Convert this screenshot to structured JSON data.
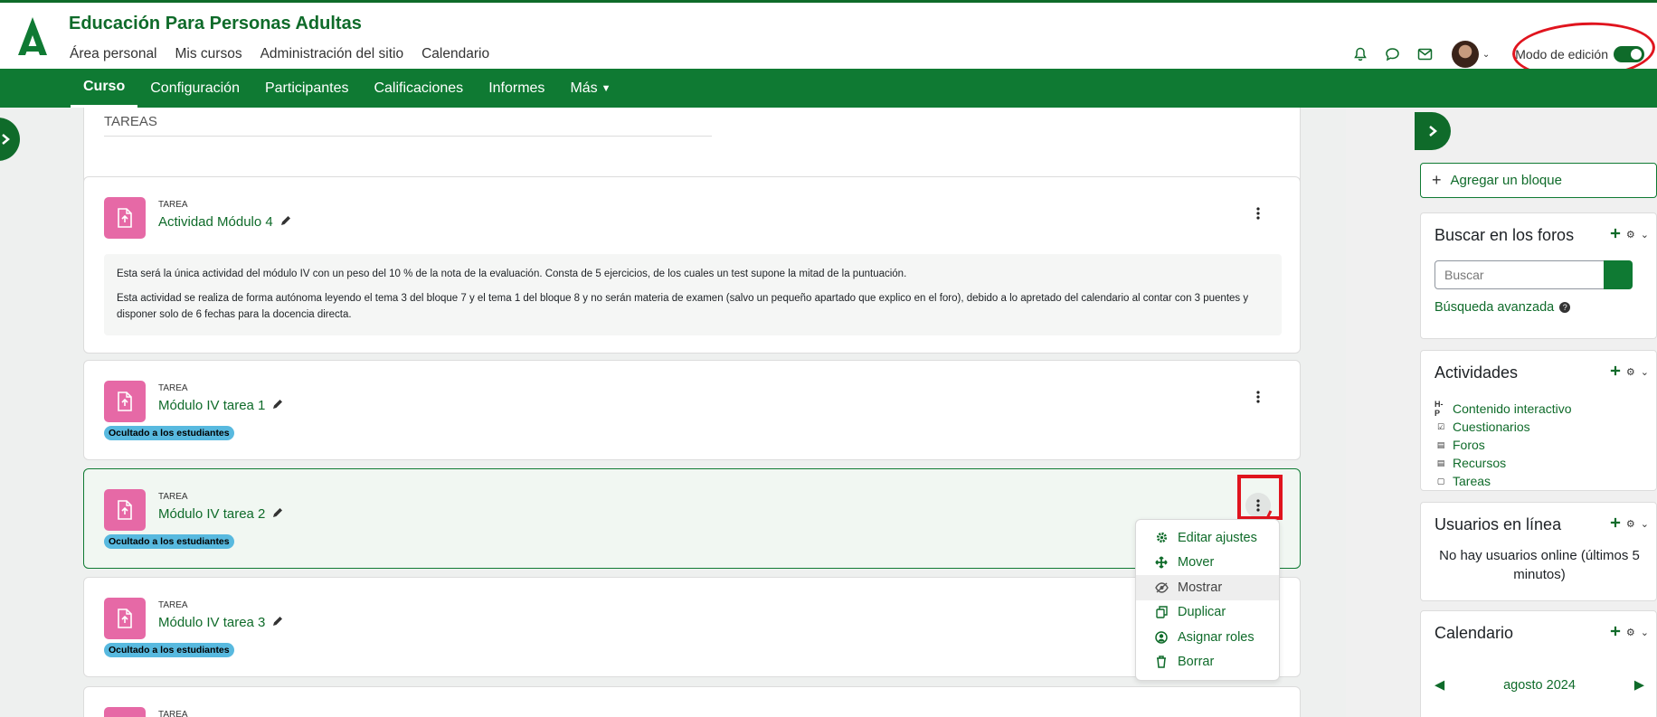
{
  "site": {
    "title": "Educación Para Personas Adultas"
  },
  "primary_nav": [
    "Área personal",
    "Mis cursos",
    "Administración del sitio",
    "Calendario"
  ],
  "header": {
    "edit_mode_label": "Modo de edición",
    "edit_mode_on": true
  },
  "secondary_nav": [
    "Curso",
    "Configuración",
    "Participantes",
    "Calificaciones",
    "Informes",
    "Más"
  ],
  "section_top": {
    "title": "TAREAS"
  },
  "activities": [
    {
      "type": "TAREA",
      "name": "Actividad Módulo 4",
      "description": [
        "Esta será la única actividad del módulo IV con un peso del 10 % de la nota de la evaluación. Consta de 5 ejercicios, de los cuales un test supone la mitad de la puntuación.",
        "Esta actividad se realiza de forma autónoma leyendo el tema 3 del bloque 7 y el tema 1 del bloque 8 y no serán materia de examen (salvo un pequeño apartado que explico en el foro), debido a lo apretado del calendario al contar con 3 puentes y disponer solo de 6 fechas para la docencia directa."
      ]
    },
    {
      "type": "TAREA",
      "name": "Módulo IV tarea 1",
      "badge": "Ocultado a los estudiantes"
    },
    {
      "type": "TAREA",
      "name": "Módulo IV tarea 2",
      "badge": "Ocultado a los estudiantes"
    },
    {
      "type": "TAREA",
      "name": "Módulo IV tarea 3",
      "badge": "Ocultado a los estudiantes"
    },
    {
      "type": "TAREA"
    }
  ],
  "action_menu": [
    "Editar ajustes",
    "Mover",
    "Mostrar",
    "Duplicar",
    "Asignar roles",
    "Borrar"
  ],
  "blocks": {
    "add_block": "Agregar un bloque",
    "forum_search": {
      "title": "Buscar en los foros",
      "placeholder": "Buscar",
      "advanced": "Búsqueda avanzada"
    },
    "activities": {
      "title": "Actividades",
      "items": [
        "Contenido interactivo",
        "Cuestionarios",
        "Foros",
        "Recursos",
        "Tareas"
      ]
    },
    "online_users": {
      "title": "Usuarios en línea",
      "text": "No hay usuarios online (últimos 5 minutos)"
    },
    "calendar": {
      "title": "Calendario",
      "month": "agosto 2024"
    }
  },
  "colors": {
    "brand": "#0f7a33",
    "assignment_icon": "#e669a6",
    "badge": "#58b9df",
    "annotation": "#e0141e"
  }
}
